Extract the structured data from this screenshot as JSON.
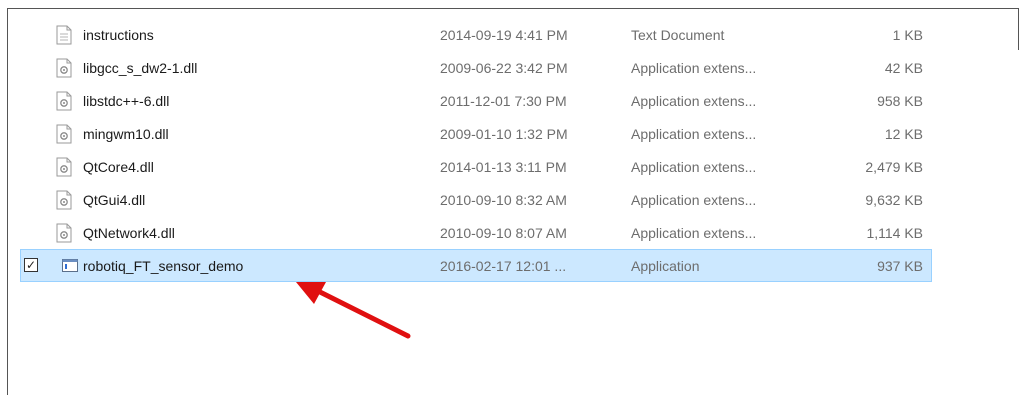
{
  "files": [
    {
      "name": "instructions",
      "date": "2014-09-19 4:41 PM",
      "type": "Text Document",
      "size": "1 KB",
      "icon": "text-document-icon"
    },
    {
      "name": "libgcc_s_dw2-1.dll",
      "date": "2009-06-22 3:42 PM",
      "type": "Application extens...",
      "size": "42 KB",
      "icon": "dll-icon"
    },
    {
      "name": "libstdc++-6.dll",
      "date": "2011-12-01 7:30 PM",
      "type": "Application extens...",
      "size": "958 KB",
      "icon": "dll-icon"
    },
    {
      "name": "mingwm10.dll",
      "date": "2009-01-10 1:32 PM",
      "type": "Application extens...",
      "size": "12 KB",
      "icon": "dll-icon"
    },
    {
      "name": "QtCore4.dll",
      "date": "2014-01-13 3:11 PM",
      "type": "Application extens...",
      "size": "2,479 KB",
      "icon": "dll-icon"
    },
    {
      "name": "QtGui4.dll",
      "date": "2010-09-10 8:32 AM",
      "type": "Application extens...",
      "size": "9,632 KB",
      "icon": "dll-icon"
    },
    {
      "name": "QtNetwork4.dll",
      "date": "2010-09-10 8:07 AM",
      "type": "Application extens...",
      "size": "1,114 KB",
      "icon": "dll-icon"
    },
    {
      "name": "robotiq_FT_sensor_demo",
      "date": "2016-02-17 12:01 ...",
      "type": "Application",
      "size": "937 KB",
      "icon": "application-icon",
      "selected": true,
      "checked": true
    }
  ],
  "colors": {
    "selection_bg": "#cce8ff",
    "selection_border": "#99d1ff",
    "annotation_arrow": "#e01010"
  },
  "annotation": {
    "icon": "red-arrow-icon"
  }
}
